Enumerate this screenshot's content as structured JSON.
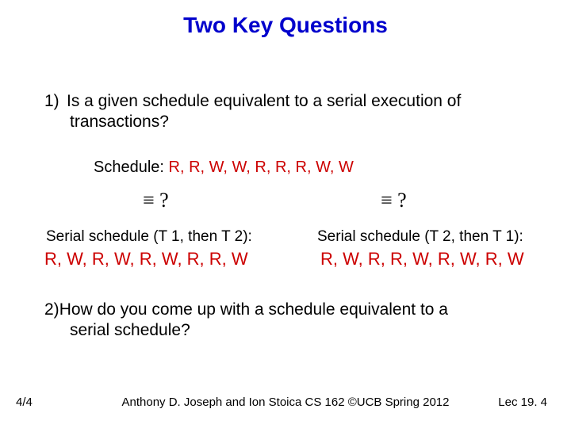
{
  "title": "Two Key Questions",
  "q1": {
    "num": "1)",
    "line1": "Is a given schedule equivalent to a serial execution of",
    "line2": "transactions?"
  },
  "schedule": {
    "label": "Schedule:",
    "ops": "R, R, W, W, R, R, R, W, W"
  },
  "equiv": {
    "left": "≡ ?",
    "right": "≡ ?"
  },
  "serial_left": {
    "label": "Serial schedule (T 1, then T 2):",
    "ops": "R, W, R, W, R, W, R, R, W"
  },
  "serial_right": {
    "label": "Serial schedule (T 2, then T 1):",
    "ops": "R, W, R, R, W, R, W, R, W"
  },
  "q2": {
    "num": "2)",
    "line1": "How do you come up with a schedule equivalent to a",
    "line2": "serial schedule?"
  },
  "footer": {
    "date": "4/4",
    "center": "Anthony D. Joseph and Ion Stoica CS 162 ©UCB Spring 2012",
    "right": "Lec 19. 4"
  }
}
